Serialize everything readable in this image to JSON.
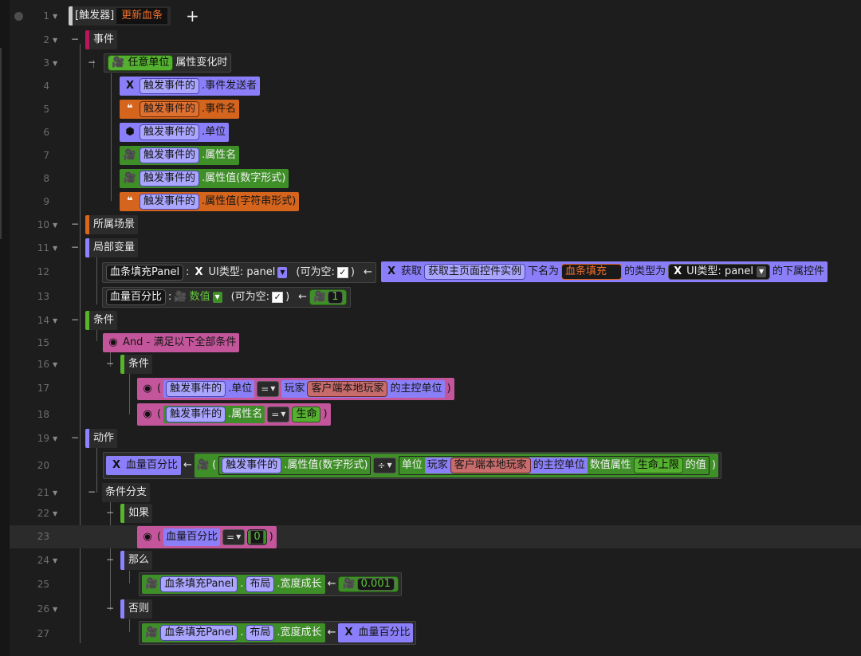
{
  "trigger": {
    "prefix": "[触发器]",
    "name": "更新血条",
    "add": "+"
  },
  "lines": [
    "1",
    "2",
    "3",
    "4",
    "5",
    "6",
    "7",
    "8",
    "9",
    "10",
    "11",
    "12",
    "13",
    "14",
    "15",
    "16",
    "17",
    "18",
    "19",
    "20",
    "21",
    "22",
    "23",
    "24",
    "25",
    "26",
    "27"
  ],
  "fold": {
    "expand": "▼",
    "collapse": "−",
    "dropdown": "▼"
  },
  "sections": {
    "event": "事件",
    "scene": "所属场景",
    "vars": "局部变量",
    "cond": "条件",
    "action": "动作"
  },
  "event": {
    "main_unit": "任意单位",
    "main_text": "属性变化时",
    "ev": "触发事件的",
    "params": [
      ".事件发送者",
      ".事件名",
      ".单位",
      ".属性名",
      ".属性值(数字形式)",
      ".属性值(字符串形式)"
    ]
  },
  "vars": {
    "v1_name": "血条填充Panel",
    "colon": ":",
    "v1_type": "UI类型: panel",
    "nullable": "(可为空:",
    "check": "✓",
    "close": ")",
    "arrow": "←",
    "get": "获取",
    "get_fn": "获取主页面控件实例",
    "named": "下名为",
    "named_val": "血条填充",
    "typed": "的类型为",
    "sub_ctrl": "的下属控件",
    "v2_name": "血量百分比",
    "v2_type": "数值",
    "v2_val": "1"
  },
  "cond": {
    "and": "And - 满足以下全部条件",
    "sub": "条件",
    "ev": "触发事件的",
    "unit": ".单位",
    "eq": "=",
    "player": "玩家",
    "client": "客户端本地玩家",
    "main_unit": "的主控单位",
    "attr_name": ".属性名",
    "life": "生命",
    "lp": "(",
    "rp": ")"
  },
  "action": {
    "target": "血量百分比",
    "attr_num": ".属性值(数字形式)",
    "div": "÷",
    "unit": "单位",
    "attr_val": "数值属性",
    "max_life": "生命上限",
    "of_val": "的值",
    "branch": "条件分支",
    "if": "如果",
    "then": "那么",
    "else": "否则",
    "zero": "0",
    "panel": "血条填充Panel",
    "dot": ".",
    "layout": "布局",
    "width": ".宽度成长",
    "num": "0.001"
  },
  "colors": {
    "bg": "#1d1d1d",
    "green": "#3f8f28",
    "purple": "#8a7ff8",
    "orange": "#d5641c",
    "magenta": "#c3559a",
    "crimson": "#b8175a"
  }
}
